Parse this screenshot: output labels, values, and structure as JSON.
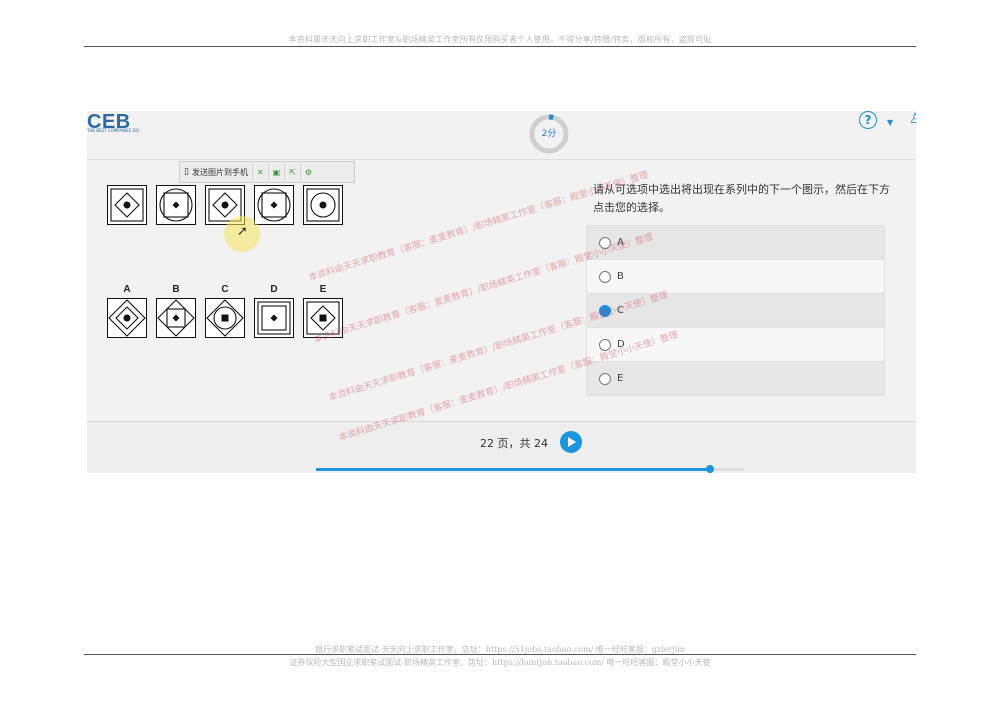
{
  "doc": {
    "header_note": "本资料属天天向上求职工作室&职场精英工作室所有仅限购买者个人使用。不得分享/转赠/转卖，版权所有，盗版可耻",
    "footer_line1": "银行求职笔试面试-天天向上求职工作室，店址：https://51jobs.taobao.com/  唯一旺旺客服：gzlerjim",
    "footer_line2": "证券保险大型国企求职笔试面试-职场精英工作室，店址：https://huntjob.taobao.com/  唯一旺旺客服：殿堂小小天使"
  },
  "app": {
    "logo": "CEB",
    "logo_sub": "THE BEST COMPANIES DO",
    "timer": {
      "label": "2分",
      "fraction": 0.04
    },
    "help_icon": "question-circle-icon",
    "account_icon": "user-icon"
  },
  "toolbar": {
    "send_label": "发送图片到手机",
    "icons": [
      "phone-icon",
      "expand-icon",
      "save-icon",
      "export-icon",
      "settings-icon"
    ]
  },
  "sequence": [
    {
      "outer": "square",
      "inner": "diamond",
      "core": "dot"
    },
    {
      "outer": "circle",
      "inner": "square",
      "core": "diamond"
    },
    {
      "outer": "square",
      "inner": "diamond",
      "core": "dot"
    },
    {
      "outer": "circle",
      "inner": "square",
      "core": "diamond"
    },
    {
      "outer": "square",
      "inner": "circle",
      "core": "dot"
    }
  ],
  "options": [
    {
      "label": "A",
      "outer": "diamond",
      "inner": "diamond",
      "core": "dot"
    },
    {
      "label": "B",
      "outer": "diamond",
      "inner": "square",
      "core": "diamond"
    },
    {
      "label": "C",
      "outer": "diamond",
      "inner": "circle",
      "core": "square"
    },
    {
      "label": "D",
      "outer": "square",
      "inner": "square",
      "core": "diamond"
    },
    {
      "label": "E",
      "outer": "square",
      "inner": "diamond",
      "core": "square"
    }
  ],
  "question": {
    "text": "请从可选项中选出将出现在系列中的下一个图示，然后在下方点击您的选择。",
    "answers": [
      {
        "label": "A",
        "selected": false
      },
      {
        "label": "B",
        "selected": false
      },
      {
        "label": "C",
        "selected": true
      },
      {
        "label": "D",
        "selected": false
      },
      {
        "label": "E",
        "selected": false
      }
    ]
  },
  "pager": {
    "text": "22 页，共 24",
    "progress": 0.92
  },
  "watermark": "本资料由天天求职教育（客服：麦麦教育）/职场精英工作室（客服：殿堂小小天使）整理",
  "colors": {
    "accent": "#1a96e0",
    "logo": "#2d6aa3"
  }
}
